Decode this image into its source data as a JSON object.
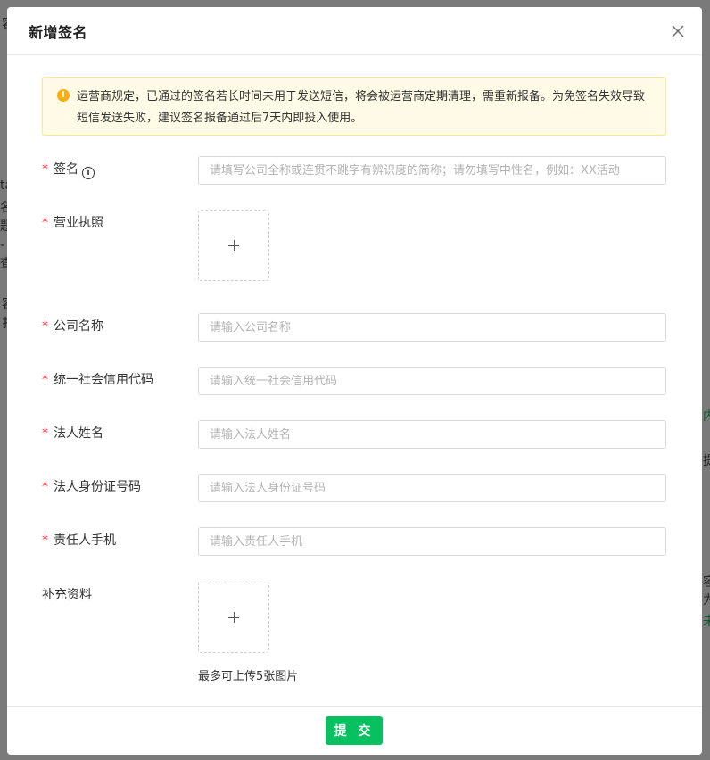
{
  "background": {
    "fragments": [
      "容",
      "ta",
      "名",
      "题",
      "- 中",
      "查",
      "容",
      "扌",
      "内",
      "提",
      "容",
      "为",
      "未"
    ]
  },
  "modal": {
    "title": "新增签名",
    "close_icon": "close-icon",
    "notice": {
      "icon": "warning-icon",
      "text": "运营商规定，已通过的签名若长时间未用于发送短信，将会被运营商定期清理，需重新报备。为免签名失效导致短信发送失败，建议签名报备通过后7天内即投入使用。"
    },
    "form": {
      "required_mark": "*",
      "signature": {
        "label": "签名",
        "info_icon": "i",
        "placeholder": "请填写公司全称或连贯不跳字有辨识度的简称；请勿填写中性名，例如：XX活动",
        "value": ""
      },
      "license": {
        "label": "营业执照"
      },
      "company_name": {
        "label": "公司名称",
        "placeholder": "请输入公司名称",
        "value": ""
      },
      "credit_code": {
        "label": "统一社会信用代码",
        "placeholder": "请输入统一社会信用代码",
        "value": ""
      },
      "legal_name": {
        "label": "法人姓名",
        "placeholder": "请输入法人姓名",
        "value": ""
      },
      "legal_id": {
        "label": "法人身份证号码",
        "placeholder": "请输入法人身份证号码",
        "value": ""
      },
      "phone": {
        "label": "责任人手机",
        "placeholder": "请输入责任人手机",
        "value": ""
      },
      "extra": {
        "label": "补充资料",
        "hint": "最多可上传5张图片"
      }
    },
    "submit_label": "提 交"
  },
  "colors": {
    "primary": "#07c160",
    "required": "#f5222d",
    "alert_bg": "#fffbe6",
    "alert_border": "#ffe58f",
    "alert_icon": "#faad14"
  }
}
